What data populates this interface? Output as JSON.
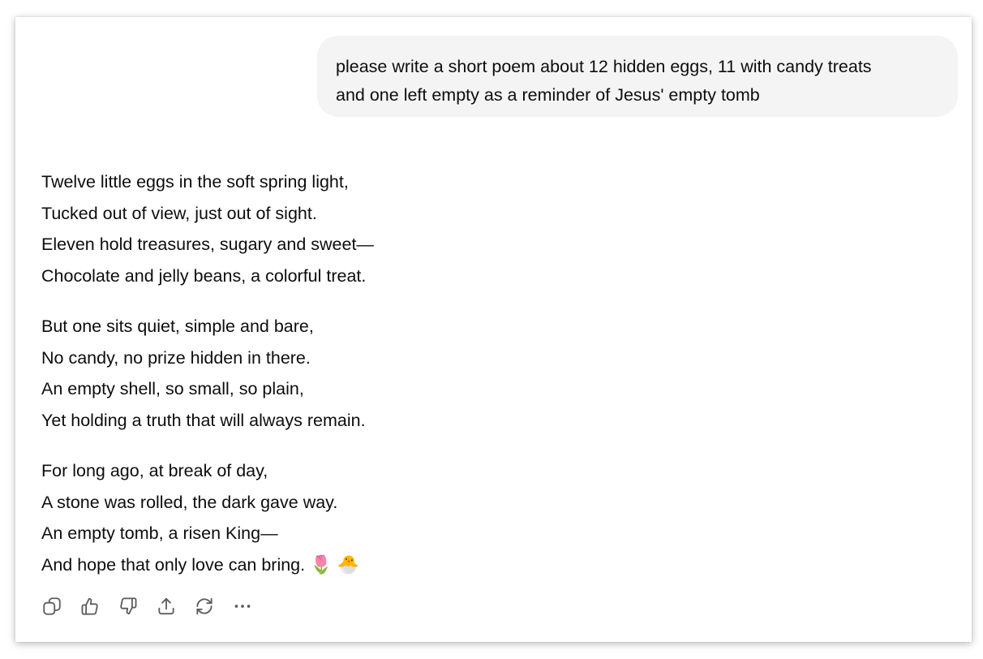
{
  "user_message": {
    "lines": [
      "please write a short poem about 12 hidden eggs, 11 with candy treats",
      "and one left empty as a reminder of Jesus' empty tomb"
    ]
  },
  "assistant_message": {
    "stanzas": [
      {
        "lines": [
          "Twelve little eggs in the soft spring light,",
          "Tucked out of view, just out of sight.",
          "Eleven hold treasures, sugary and sweet—",
          "Chocolate and jelly beans, a colorful treat."
        ]
      },
      {
        "lines": [
          "But one sits quiet, simple and bare,",
          "No candy, no prize hidden in there.",
          "An empty shell, so small, so plain,",
          "Yet holding a truth that will always remain."
        ]
      },
      {
        "lines": [
          "For long ago, at break of day,",
          "A stone was rolled, the dark gave way.",
          "An empty tomb, a risen King—",
          "And hope that only love can bring."
        ]
      }
    ],
    "trailing_emoji": [
      "🌷",
      "🐣"
    ]
  },
  "actions": [
    {
      "name": "copy-button",
      "icon": "copy-icon"
    },
    {
      "name": "thumbs-up-button",
      "icon": "thumbs-up-icon"
    },
    {
      "name": "thumbs-down-button",
      "icon": "thumbs-down-icon"
    },
    {
      "name": "share-button",
      "icon": "share-icon"
    },
    {
      "name": "regenerate-button",
      "icon": "regenerate-icon"
    },
    {
      "name": "more-options-button",
      "icon": "more-icon"
    }
  ],
  "colors": {
    "bubble_background": "#f4f4f4",
    "text": "#0d0d0d",
    "icon": "#5d5d5d"
  }
}
